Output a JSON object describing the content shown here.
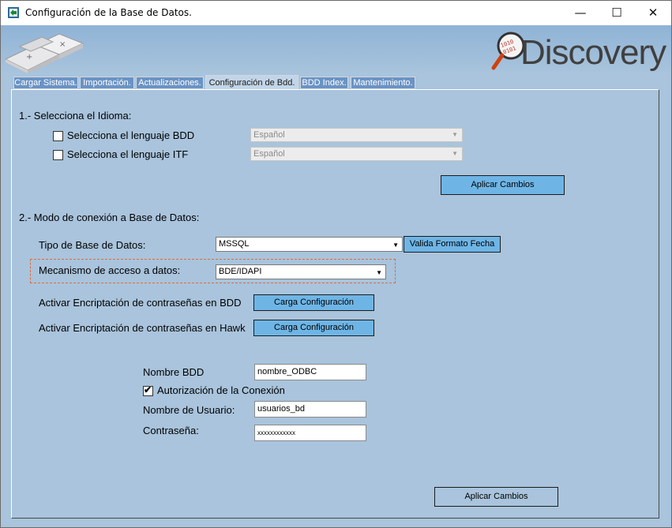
{
  "window": {
    "title": "Configuración de la Base de Datos.",
    "controls": {
      "minimize": "—",
      "maximize": "☐",
      "close": "✕"
    }
  },
  "banner": {
    "logo_text": "Discovery",
    "logo_badge": "1010 0101"
  },
  "tabs": [
    {
      "label": "Cargar Sistema."
    },
    {
      "label": "Importación."
    },
    {
      "label": "Actualizaciones."
    },
    {
      "label": "Configuración de Bdd."
    },
    {
      "label": "BDD Index."
    },
    {
      "label": "Mantenimiento."
    }
  ],
  "active_tab": "Configuración de Bdd.",
  "section1": {
    "heading": "1.- Selecciona el Idioma:",
    "bdd_label": "Selecciona el lenguaje BDD",
    "itf_label": "Selecciona el lenguaje ITF",
    "bdd_value": "Español",
    "itf_value": "Español",
    "bdd_checked": false,
    "itf_checked": false,
    "apply_button": "Aplicar Cambios"
  },
  "section2": {
    "heading": "2.- Modo de conexión a Base de Datos:",
    "tipo_label": "Tipo de Base de Datos:",
    "tipo_value": "MSSQL",
    "valida_button": "Valida Formato Fecha",
    "mecanismo_label": "Mecanismo de acceso a datos:",
    "mecanismo_value": "BDE/IDAPI",
    "encrypt_bdd_label": "Activar Encriptación de contraseñas en BDD",
    "encrypt_hawk_label": "Activar Encriptación de contraseñas en Hawk",
    "carga_button": "Carga Configuración"
  },
  "credentials": {
    "nombre_bdd_label": "Nombre BDD",
    "nombre_bdd_value": "nombre_ODBC",
    "autorizacion_label": "Autorización de la Conexión",
    "autorizacion_checked": true,
    "usuario_label": "Nombre de Usuario:",
    "usuario_value": "usuarios_bd",
    "password_label": "Contraseña:",
    "password_value": "xxxxxxxxxxxx"
  },
  "footer": {
    "apply_button": "Aplicar Cambios"
  },
  "colors": {
    "panel_bg": "#a9c4dc",
    "button_bg": "#6eb5e6",
    "tab_bg": "#6a93c4",
    "highlight_border": "#e26a3a"
  }
}
